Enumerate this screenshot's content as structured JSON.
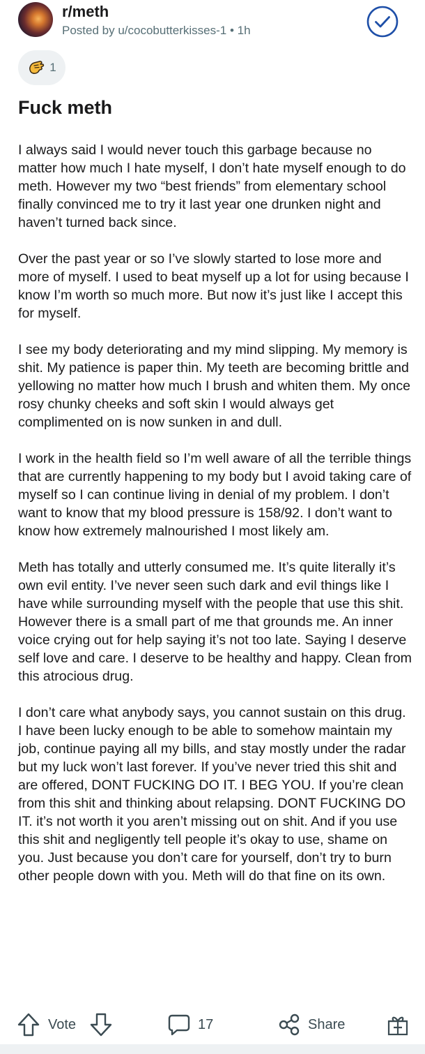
{
  "post": {
    "subreddit": "r/meth",
    "posted_by": "Posted by u/cocobutterkisses-1",
    "separator": " • ",
    "time_ago": "1h",
    "award_count": "1",
    "title": "Fuck meth",
    "paragraphs": [
      "I always said I would never touch this garbage because no matter how much I hate myself, I don’t hate myself enough to do meth. However my two “best friends” from elementary school finally convinced me to try it last year one drunken night and haven’t turned back since.",
      "Over the past year or so I’ve slowly started to lose more and more of myself. I used to beat myself up a lot for using because I know I’m worth so much more. But now it’s just like I accept this for myself.",
      "I see my body deteriorating and my mind slipping. My memory is shit. My patience is paper thin. My teeth are becoming brittle and yellowing no matter how much I brush and whiten them. My once rosy chunky cheeks and soft skin I would always get complimented on is now sunken in and dull.",
      "I work in the health field so I’m well aware of all the terrible things that are currently happening to my body but I avoid taking care of myself so I can continue living in denial of my problem. I don’t want to know that my blood pressure is 158/92. I don’t want to know how extremely malnourished I most likely am.",
      "Meth has totally and utterly consumed me. It’s quite literally it’s own evil entity. I’ve never seen such dark and evil things like I have while surrounding myself with the people that use this shit. However there is a small part of me that grounds me. An inner voice crying out for help saying it’s not too late. Saying I deserve self love and care. I deserve to be healthy and happy. Clean from this atrocious drug.",
      "I don’t care what anybody says, you cannot sustain on this drug. I have been lucky enough to be able to somehow maintain my job, continue paying all my bills, and stay mostly under the radar but my luck won’t last forever. If you’ve never tried this shit and are offered, DONT FUCKING DO IT. I BEG YOU. If you’re clean from this shit and thinking about relapsing. DONT FUCKING DO IT. it’s not worth it you aren’t missing out on shit. And if you use this shit and negligently tell people it’s okay to use, shame on you. Just because you don’t care for yourself, don’t try to burn other people down with you. Meth will do that fine on its own."
    ]
  },
  "actions": {
    "vote_label": "Vote",
    "comment_count": "17",
    "share_label": "Share"
  },
  "icons": {
    "subscribed": "check-circle-icon",
    "award": "award-hand-icon",
    "upvote": "arrow-up-icon",
    "downvote": "arrow-down-icon",
    "comment": "comment-bubble-icon",
    "share": "share-icon",
    "gift": "gift-icon"
  },
  "colors": {
    "text": "#1a1a1b",
    "meta": "#576f76",
    "check_blue": "#1e4fa8",
    "icon_gray": "#3b4b52",
    "pill_bg": "#eef1f3"
  }
}
